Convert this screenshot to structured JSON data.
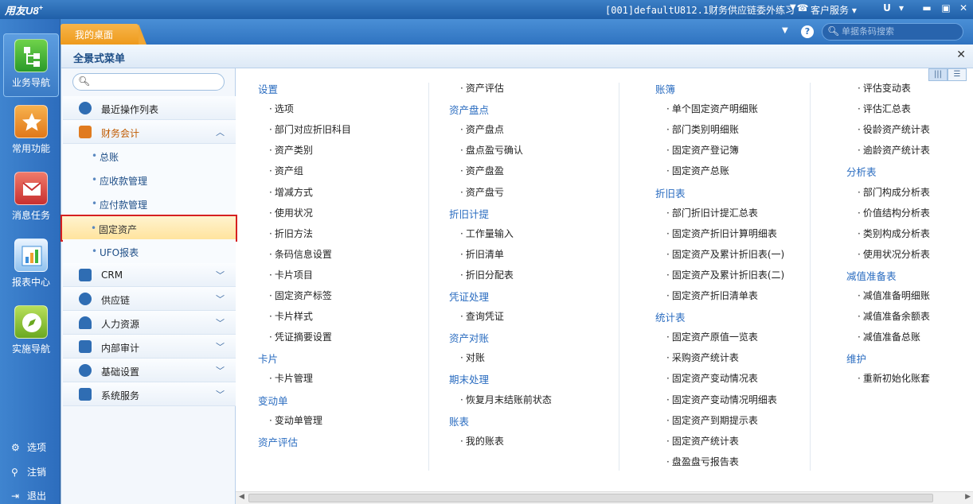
{
  "titlebar": {
    "logo": "用友U8",
    "logo_sup": "+",
    "account": "[001]defaultU812.1财务供应链委外练习",
    "service": "客户服务",
    "u_icon": "U",
    "menu_icon": "▾",
    "min_icon": "▬",
    "max_icon": "▣",
    "close_icon": "✕"
  },
  "leftnav": {
    "items": [
      {
        "label": "业务导航",
        "icon": "business-nav-icon",
        "color": "#3cb43c"
      },
      {
        "label": "常用功能",
        "icon": "star-icon",
        "color": "#f08a20"
      },
      {
        "label": "消息任务",
        "icon": "mail-icon",
        "color": "#d94040"
      },
      {
        "label": "报表中心",
        "icon": "report-icon",
        "color": "#3d8fd9"
      },
      {
        "label": "实施导航",
        "icon": "compass-icon",
        "color": "#7fbf2a"
      }
    ],
    "bottom": [
      {
        "label": "选项",
        "icon": "⚙"
      },
      {
        "label": "注销",
        "icon": "⚲"
      },
      {
        "label": "退出",
        "icon": "⇥"
      }
    ]
  },
  "tabs": {
    "desktop": "我的桌面",
    "search_placeholder": "单据条码搜索"
  },
  "panel": {
    "title": "全景式菜单",
    "close": "✕",
    "view_grid": "|||",
    "view_list": "☰"
  },
  "catmenu": {
    "search_placeholder": "",
    "categories": [
      {
        "label": "最近操作列表",
        "icon": "clock-icon",
        "color": "#2f6db3"
      },
      {
        "label": "财务会计",
        "icon": "finance-icon",
        "color": "#e07b1f",
        "chevron": "︿"
      },
      {
        "label": "CRM",
        "icon": "crm-icon",
        "color": "#2f6db3",
        "chevron": "﹀"
      },
      {
        "label": "供应链",
        "icon": "supply-chain-icon",
        "color": "#2f6db3",
        "chevron": "﹀"
      },
      {
        "label": "人力资源",
        "icon": "hr-icon",
        "color": "#2f6db3",
        "chevron": "﹀"
      },
      {
        "label": "内部审计",
        "icon": "audit-icon",
        "color": "#2f6db3",
        "chevron": "﹀"
      },
      {
        "label": "基础设置",
        "icon": "settings-icon",
        "color": "#2f6db3",
        "chevron": "﹀"
      },
      {
        "label": "系统服务",
        "icon": "system-service-icon",
        "color": "#2f6db3",
        "chevron": "﹀"
      }
    ],
    "subitems": [
      "总账",
      "应收款管理",
      "应付款管理",
      "固定资产",
      "UFO报表"
    ]
  },
  "columns": [
    [
      {
        "t": "h",
        "text": "设置"
      },
      {
        "t": "i",
        "text": "选项"
      },
      {
        "t": "i",
        "text": "部门对应折旧科目"
      },
      {
        "t": "i",
        "text": "资产类别"
      },
      {
        "t": "i",
        "text": "资产组"
      },
      {
        "t": "i",
        "text": "增减方式"
      },
      {
        "t": "i",
        "text": "使用状况"
      },
      {
        "t": "i",
        "text": "折旧方法"
      },
      {
        "t": "i",
        "text": "条码信息设置"
      },
      {
        "t": "i",
        "text": "卡片项目"
      },
      {
        "t": "i",
        "text": "固定资产标签"
      },
      {
        "t": "i",
        "text": "卡片样式"
      },
      {
        "t": "i",
        "text": "凭证摘要设置"
      },
      {
        "t": "h",
        "text": "卡片"
      },
      {
        "t": "i",
        "text": "卡片管理"
      },
      {
        "t": "h",
        "text": "变动单"
      },
      {
        "t": "i",
        "text": "变动单管理"
      },
      {
        "t": "h",
        "text": "资产评估"
      }
    ],
    [
      {
        "t": "i",
        "text": "资产评估"
      },
      {
        "t": "h",
        "text": "资产盘点"
      },
      {
        "t": "i",
        "text": "资产盘点"
      },
      {
        "t": "i",
        "text": "盘点盈亏确认"
      },
      {
        "t": "i",
        "text": "资产盘盈"
      },
      {
        "t": "i",
        "text": "资产盘亏"
      },
      {
        "t": "h",
        "text": "折旧计提"
      },
      {
        "t": "i",
        "text": "工作量输入"
      },
      {
        "t": "i",
        "text": "折旧清单"
      },
      {
        "t": "i",
        "text": "折旧分配表"
      },
      {
        "t": "h",
        "text": "凭证处理"
      },
      {
        "t": "i",
        "text": "查询凭证"
      },
      {
        "t": "h",
        "text": "资产对账"
      },
      {
        "t": "i",
        "text": "对账"
      },
      {
        "t": "h",
        "text": "期末处理"
      },
      {
        "t": "i",
        "text": "恢复月末结账前状态"
      },
      {
        "t": "h",
        "text": "账表"
      },
      {
        "t": "i",
        "text": "我的账表"
      }
    ],
    [
      {
        "t": "h",
        "text": "账簿"
      },
      {
        "t": "i",
        "text": "单个固定资产明细账"
      },
      {
        "t": "i",
        "text": "部门类别明细账"
      },
      {
        "t": "i",
        "text": "固定资产登记簿"
      },
      {
        "t": "i",
        "text": "固定资产总账"
      },
      {
        "t": "h",
        "text": "折旧表"
      },
      {
        "t": "i",
        "text": "部门折旧计提汇总表"
      },
      {
        "t": "i",
        "text": "固定资产折旧计算明细表"
      },
      {
        "t": "i",
        "text": "固定资产及累计折旧表(一)"
      },
      {
        "t": "i",
        "text": "固定资产及累计折旧表(二)"
      },
      {
        "t": "i",
        "text": "固定资产折旧清单表"
      },
      {
        "t": "h",
        "text": "统计表"
      },
      {
        "t": "i",
        "text": "固定资产原值一览表"
      },
      {
        "t": "i",
        "text": "采购资产统计表"
      },
      {
        "t": "i",
        "text": "固定资产变动情况表"
      },
      {
        "t": "i",
        "text": "固定资产变动情况明细表"
      },
      {
        "t": "i",
        "text": "固定资产到期提示表"
      },
      {
        "t": "i",
        "text": "固定资产统计表"
      },
      {
        "t": "i",
        "text": "盘盈盘亏报告表"
      }
    ],
    [
      {
        "t": "i",
        "text": "评估变动表"
      },
      {
        "t": "i",
        "text": "评估汇总表"
      },
      {
        "t": "i",
        "text": "役龄资产统计表"
      },
      {
        "t": "i",
        "text": "逾龄资产统计表"
      },
      {
        "t": "h",
        "text": "分析表"
      },
      {
        "t": "i",
        "text": "部门构成分析表"
      },
      {
        "t": "i",
        "text": "价值结构分析表"
      },
      {
        "t": "i",
        "text": "类别构成分析表"
      },
      {
        "t": "i",
        "text": "使用状况分析表"
      },
      {
        "t": "h",
        "text": "减值准备表"
      },
      {
        "t": "i",
        "text": "减值准备明细账"
      },
      {
        "t": "i",
        "text": "减值准备余额表"
      },
      {
        "t": "i",
        "text": "减值准备总账"
      },
      {
        "t": "h",
        "text": "维护"
      },
      {
        "t": "i",
        "text": "重新初始化账套"
      }
    ]
  ]
}
